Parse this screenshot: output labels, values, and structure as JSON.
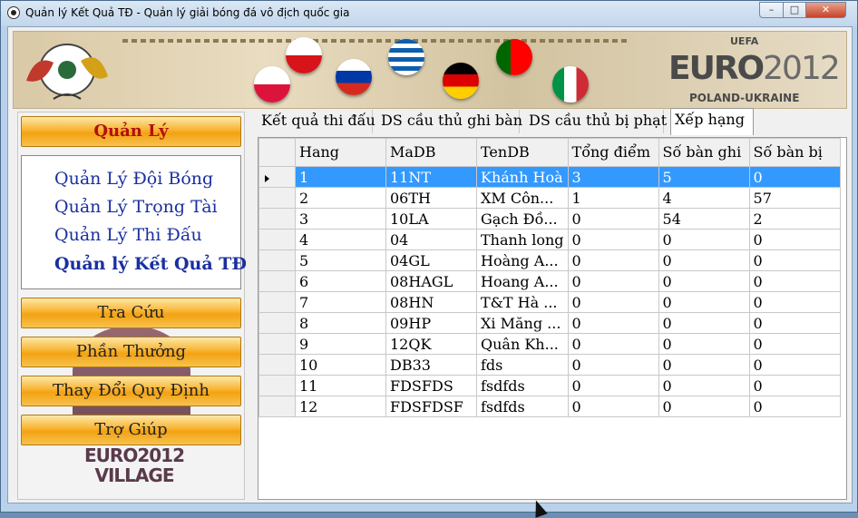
{
  "window": {
    "title": "Quản lý Kết Quả TĐ - Quản lý giải bóng đá vô địch quốc gia",
    "controls": {
      "minimize": "–",
      "maximize": "□",
      "close": "✕"
    }
  },
  "banner": {
    "logo_main": "EURO",
    "logo_year": "2012",
    "uefa": "UEFA",
    "subtitle": "POLAND-UKRAINE"
  },
  "sidebar": {
    "main_button": "Quản Lý",
    "submenu": [
      {
        "label": "Quản Lý Đội Bóng"
      },
      {
        "label": "Quản Lý Trọng Tài"
      },
      {
        "label": "Quản Lý Thi Đấu"
      },
      {
        "label": "Quản lý Kết Quả TĐ"
      }
    ],
    "buttons": [
      "Tra Cứu",
      "Phần Thưởng",
      "Thay Đổi Quy Định",
      "Trợ Giúp"
    ],
    "village_logo": "EURO2012 VILLAGE"
  },
  "tabs": [
    {
      "label": "Kết quả thi đấu"
    },
    {
      "label": "DS cầu thủ ghi bàn"
    },
    {
      "label": "DS cầu thủ bị phạt"
    },
    {
      "label": "Xếp hạng"
    }
  ],
  "grid": {
    "columns": [
      "Hang",
      "MaDB",
      "TenDB",
      "Tổng điểm",
      "Số bàn ghi",
      "Số bàn bị"
    ],
    "rows": [
      [
        "1",
        "11NT",
        "Khánh Hoà",
        "3",
        "5",
        "0"
      ],
      [
        "2",
        "06TH",
        "XM Côn...",
        "1",
        "4",
        "57"
      ],
      [
        "3",
        "10LA",
        "Gạch Đồ...",
        "0",
        "54",
        "2"
      ],
      [
        "4",
        "04",
        "Thanh long",
        "0",
        "0",
        "0"
      ],
      [
        "5",
        "04GL",
        "Hoàng A...",
        "0",
        "0",
        "0"
      ],
      [
        "6",
        "08HAGL",
        "Hoang A...",
        "0",
        "0",
        "0"
      ],
      [
        "7",
        "08HN",
        "T&T Hà ...",
        "0",
        "0",
        "0"
      ],
      [
        "8",
        "09HP",
        "Xi Măng ...",
        "0",
        "0",
        "0"
      ],
      [
        "9",
        "12QK",
        "Quân Kh...",
        "0",
        "0",
        "0"
      ],
      [
        "10",
        "DB33",
        "fds",
        "0",
        "0",
        "0"
      ],
      [
        "11",
        "FDSFDS",
        "fsdfds",
        "0",
        "0",
        "0"
      ],
      [
        "12",
        "FDSFDSF",
        "fsdfds",
        "0",
        "0",
        "0"
      ]
    ]
  }
}
